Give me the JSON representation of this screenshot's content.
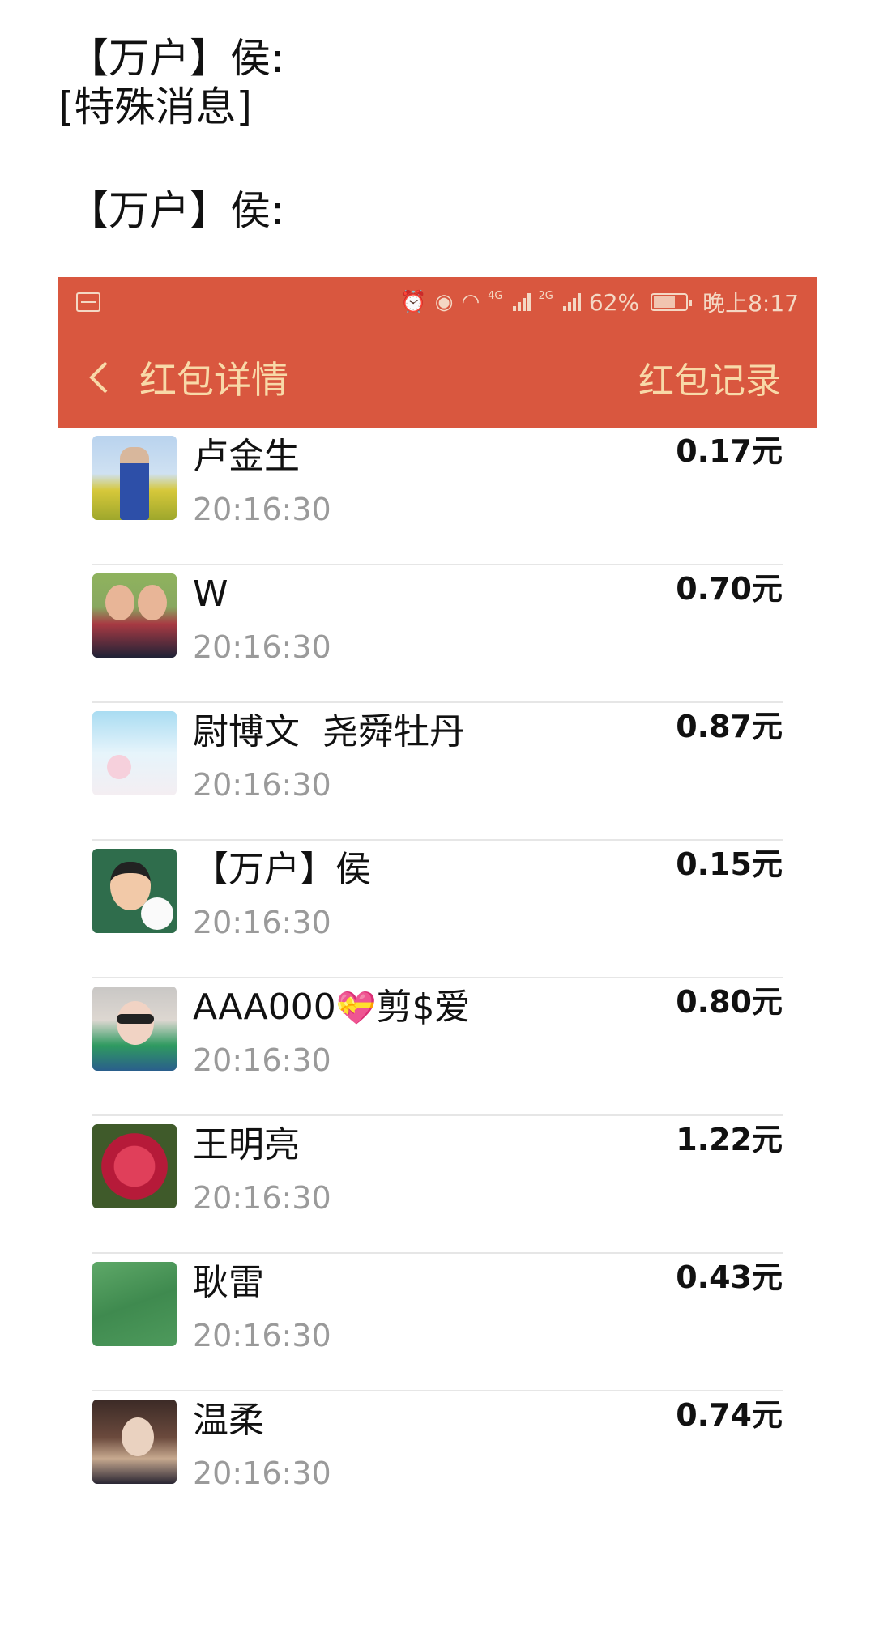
{
  "chat": {
    "sender_1": "【万户】侯:",
    "special_message": "[特殊消息]",
    "sender_2": "【万户】侯:"
  },
  "status_bar": {
    "battery": "62%",
    "network_1": "4G",
    "network_2": "2G",
    "time": "晚上8:17",
    "icons": [
      "activity-icon",
      "alarm-icon",
      "eye-icon",
      "wifi-icon",
      "signal-icon",
      "battery-icon"
    ]
  },
  "header": {
    "title": "红包详情",
    "record_link": "红包记录",
    "back_icon": "chevron-left-icon",
    "background": "#d9573f",
    "text_color": "#f8d9a8"
  },
  "recipients": [
    {
      "name": "卢金生",
      "time": "20:16:30",
      "amount": "0.17元"
    },
    {
      "name": "W",
      "time": "20:16:30",
      "amount": "0.70元"
    },
    {
      "name": "尉博文  尧舜牡丹",
      "time": "20:16:30",
      "amount": "0.87元"
    },
    {
      "name": "【万户】侯",
      "time": "20:16:30",
      "amount": "0.15元"
    },
    {
      "name_prefix": "AAA000",
      "name_suffix": "剪$爱",
      "time": "20:16:30",
      "amount": "0.80元"
    },
    {
      "name": "王明亮",
      "time": "20:16:30",
      "amount": "1.22元"
    },
    {
      "name": "耿雷",
      "time": "20:16:30",
      "amount": "0.43元"
    },
    {
      "name": "温柔",
      "time": "20:16:30",
      "amount": "0.74元"
    }
  ]
}
